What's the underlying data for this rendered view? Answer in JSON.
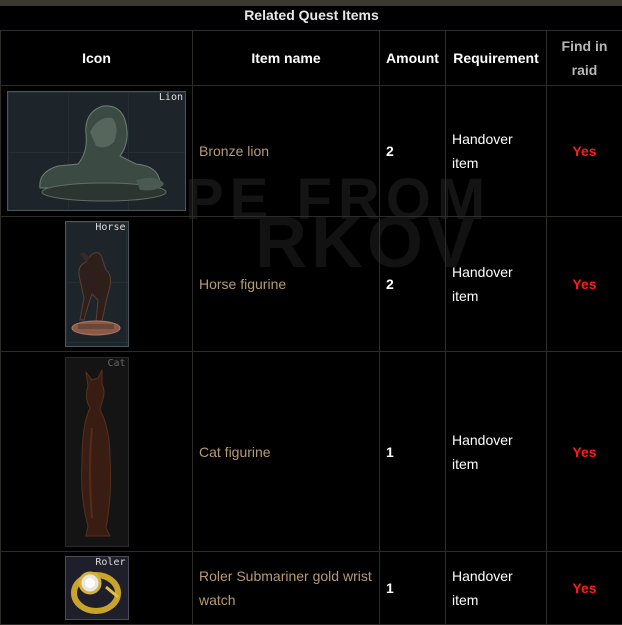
{
  "table": {
    "caption": "Related Quest Items",
    "headers": [
      "Icon",
      "Item name",
      "Amount",
      "Requirement",
      "Find in raid"
    ],
    "rows": [
      {
        "icon": "bronze-lion-icon",
        "icon_tag": "Lion",
        "name": "Bronze lion",
        "amount": "2",
        "requirement": "Handover item",
        "fir": "Yes"
      },
      {
        "icon": "horse-figurine-icon",
        "icon_tag": "Horse",
        "name": "Horse figurine",
        "amount": "2",
        "requirement": "Handover item",
        "fir": "Yes"
      },
      {
        "icon": "cat-figurine-icon",
        "icon_tag": "Cat",
        "name": "Cat figurine",
        "amount": "1",
        "requirement": "Handover item",
        "fir": "Yes"
      },
      {
        "icon": "gold-watch-icon",
        "icon_tag": "Roler",
        "name": "Roler Submariner gold wrist watch",
        "amount": "1",
        "requirement": "Handover item",
        "fir": "Yes"
      }
    ]
  },
  "colors": {
    "name_text": "#b79b74",
    "fir_yes": "#ff1a1a",
    "border": "#2e2c28"
  }
}
